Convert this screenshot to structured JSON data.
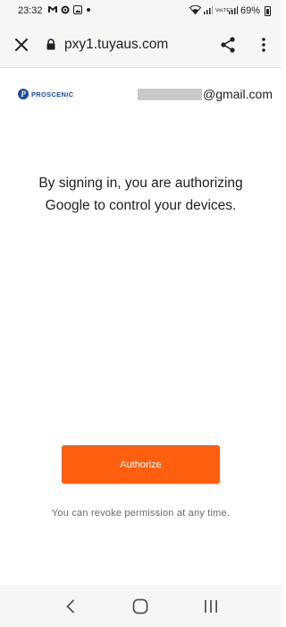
{
  "status_bar": {
    "time": "23:32",
    "battery": "69%",
    "icons_left": [
      "gmail-icon",
      "settings-icon",
      "image-icon",
      "dot-icon"
    ],
    "icons_right": [
      "wifi-icon",
      "signal-icon",
      "volte-icon",
      "signal-icon",
      "battery-icon"
    ],
    "volte_label": "VoLTE2"
  },
  "toolbar": {
    "url": "pxy1.tuyaus.com",
    "close_icon": "close-icon",
    "lock_icon": "lock-icon",
    "share_icon": "share-icon",
    "more_icon": "more-vert-icon"
  },
  "page": {
    "brand": "PROSCENIC",
    "account_suffix": "@gmail.com",
    "message": "By signing in, you are authorizing Google to control your devices.",
    "authorize_label": "Authorize",
    "revoke_note": "You can revoke permission at any time.",
    "accent_color": "#ff5f0f"
  },
  "nav_bar": {
    "buttons": [
      "back-icon",
      "home-icon",
      "recents-icon"
    ]
  }
}
